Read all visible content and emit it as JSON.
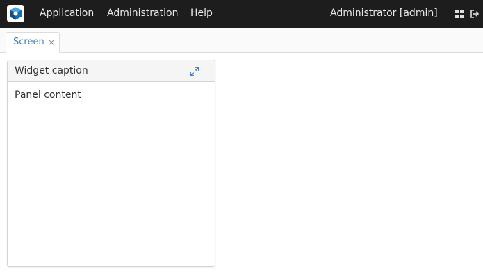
{
  "topbar": {
    "menu": [
      {
        "label": "Application"
      },
      {
        "label": "Administration"
      },
      {
        "label": "Help"
      }
    ],
    "user_label": "Administrator [admin]",
    "icons": [
      "grid-icon",
      "logout-icon"
    ],
    "logo_icon": "app-logo-icon"
  },
  "tabs": [
    {
      "label": "Screen",
      "close": "×",
      "active": true
    }
  ],
  "panel": {
    "caption": "Widget caption",
    "content": "Panel content",
    "expand_icon": "expand-icon"
  },
  "colors": {
    "topbar_bg": "#1d1d1d",
    "accent": "#3b7fc4"
  }
}
